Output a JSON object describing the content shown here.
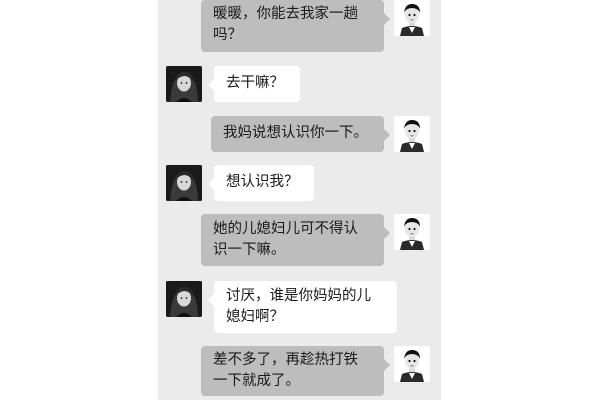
{
  "chat": {
    "messages": [
      {
        "sender": "me",
        "avatar": "boy-cartoon-avatar",
        "text": "暖暖，你能去我家一趟吗？"
      },
      {
        "sender": "her",
        "avatar": "girl-photo-avatar",
        "text": "去干嘛？"
      },
      {
        "sender": "me",
        "avatar": "boy-cartoon-avatar",
        "text": "我妈说想认识你一下。"
      },
      {
        "sender": "her",
        "avatar": "girl-photo-avatar",
        "text": "想认识我？"
      },
      {
        "sender": "me",
        "avatar": "boy-cartoon-avatar",
        "text": "她的儿媳妇儿可不得认识一下嘛。"
      },
      {
        "sender": "her",
        "avatar": "girl-photo-avatar",
        "text": "讨厌，谁是你妈妈的儿媳妇啊？"
      },
      {
        "sender": "me",
        "avatar": "boy-cartoon-avatar",
        "text": "差不多了，再趁热打铁一下就成了。"
      }
    ]
  },
  "colors": {
    "chat_background": "#ebebeb",
    "my_bubble": "#bdbdbd",
    "her_bubble": "#ffffff",
    "text": "#1a1a1a"
  }
}
